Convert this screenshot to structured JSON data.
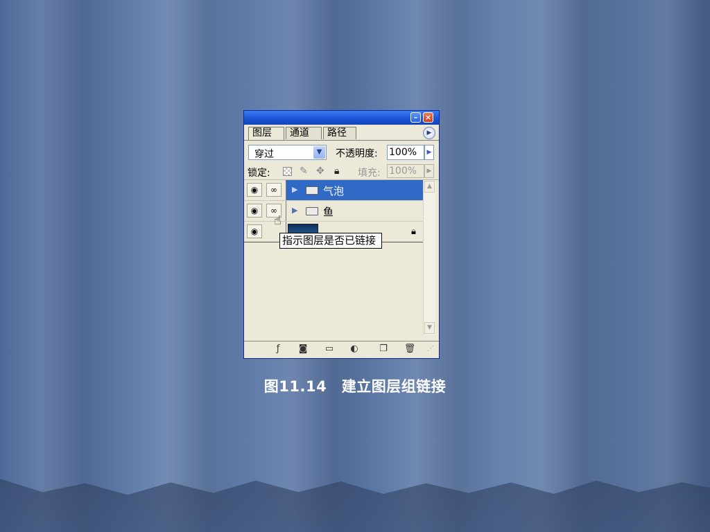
{
  "tabs": [
    "图层",
    "通道",
    "路径"
  ],
  "blend_mode": "穿过",
  "opacity_label": "不透明度:",
  "opacity_value": "100%",
  "lock_label": "锁定:",
  "fill_label": "填充:",
  "fill_value": "100%",
  "layers": [
    {
      "name": "气泡",
      "selected": true,
      "type": "group"
    },
    {
      "name": "鱼",
      "selected": false,
      "type": "group"
    },
    {
      "name": "",
      "selected": false,
      "type": "layer"
    }
  ],
  "tooltip": "指示图层是否已链接",
  "caption": "图11.14　建立图层组链接",
  "colors": {
    "selection": "#3169c6",
    "titlebar": "#1c55d8",
    "panel_bg": "#ece9d8"
  }
}
